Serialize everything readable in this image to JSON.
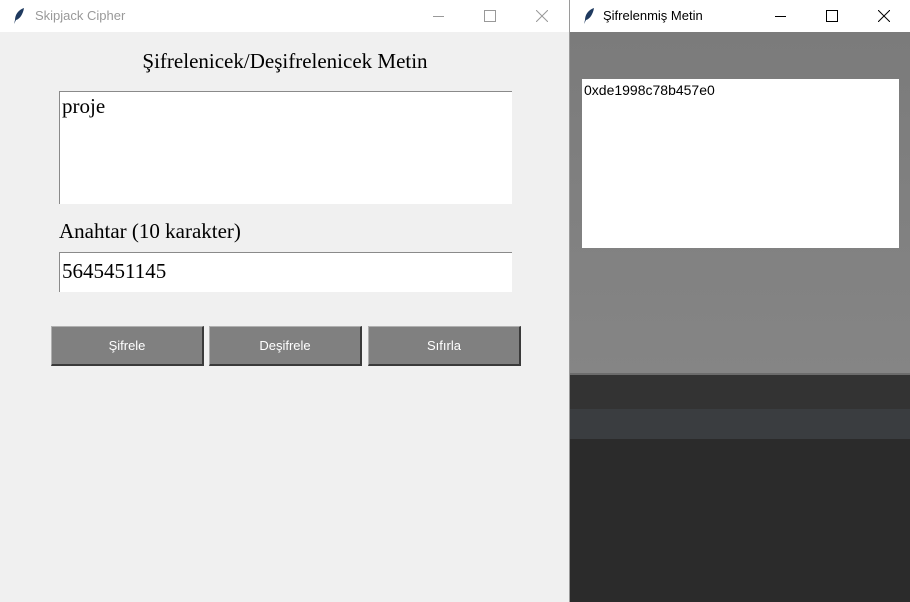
{
  "main_window": {
    "title": "Skipjack Cipher",
    "heading": "Şifrelenicek/Deşifrelenicek Metin",
    "text_value": "proje",
    "key_label": "Anahtar (10 karakter)",
    "key_value": "5645451145",
    "buttons": {
      "encrypt": "Şifrele",
      "decrypt": "Deşifrele",
      "reset": "Sıfırla"
    }
  },
  "side_window": {
    "title": "Şifrelenmiş Metin",
    "output": "0xde1998c78b457e0"
  },
  "icons": [
    "feather-icon",
    "minimize-icon",
    "maximize-icon",
    "close-icon"
  ],
  "colors": {
    "button_bg": "#808080",
    "window_bg": "#f0f0f0",
    "side_bg": "#808080"
  }
}
